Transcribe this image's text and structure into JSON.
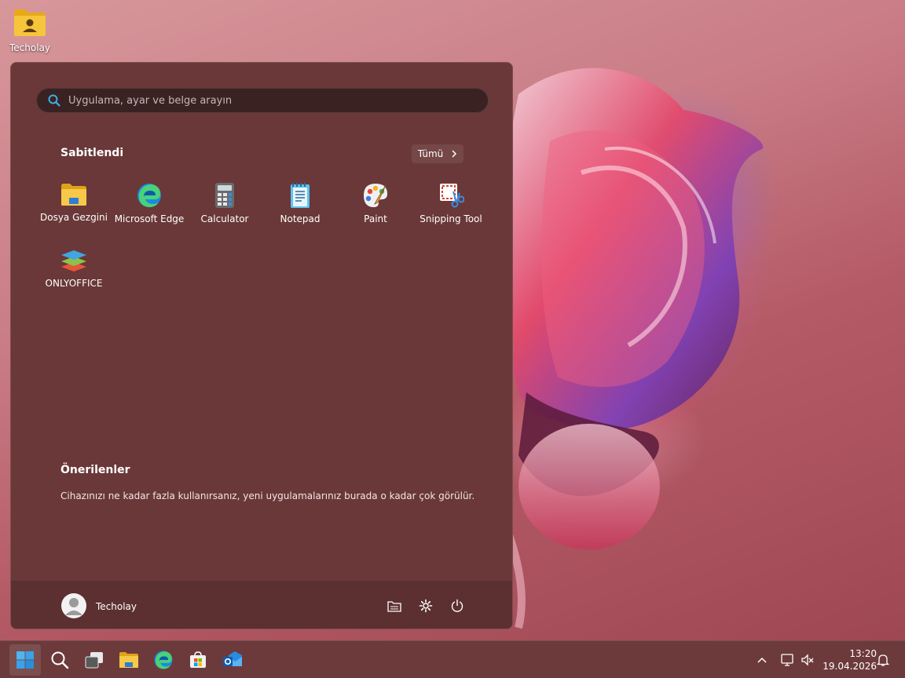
{
  "desktop": {
    "icon_label": "Techolay"
  },
  "start_menu": {
    "search_placeholder": "Uygulama, ayar ve belge arayın",
    "pinned_title": "Sabitlendi",
    "all_button_label": "Tümü",
    "pinned_apps": [
      {
        "label": "Dosya Gezgini",
        "icon": "file-explorer-icon"
      },
      {
        "label": "Microsoft Edge",
        "icon": "edge-icon"
      },
      {
        "label": "Calculator",
        "icon": "calculator-icon"
      },
      {
        "label": "Notepad",
        "icon": "notepad-icon"
      },
      {
        "label": "Paint",
        "icon": "paint-icon"
      },
      {
        "label": "Snipping Tool",
        "icon": "snipping-tool-icon"
      },
      {
        "label": "ONLYOFFICE",
        "icon": "onlyoffice-icon"
      }
    ],
    "recommended_title": "Önerilenler",
    "recommended_text": "Cihazınızı ne kadar fazla kullanırsanız, yeni uygulamalarınız burada o kadar çok görülür.",
    "user_name": "Techolay"
  },
  "taskbar": {
    "items": [
      "start-icon",
      "search-icon",
      "task-view-icon",
      "file-explorer-icon",
      "edge-icon",
      "store-icon",
      "outlook-icon"
    ],
    "time": "13:20",
    "date": "19.04.2026"
  }
}
